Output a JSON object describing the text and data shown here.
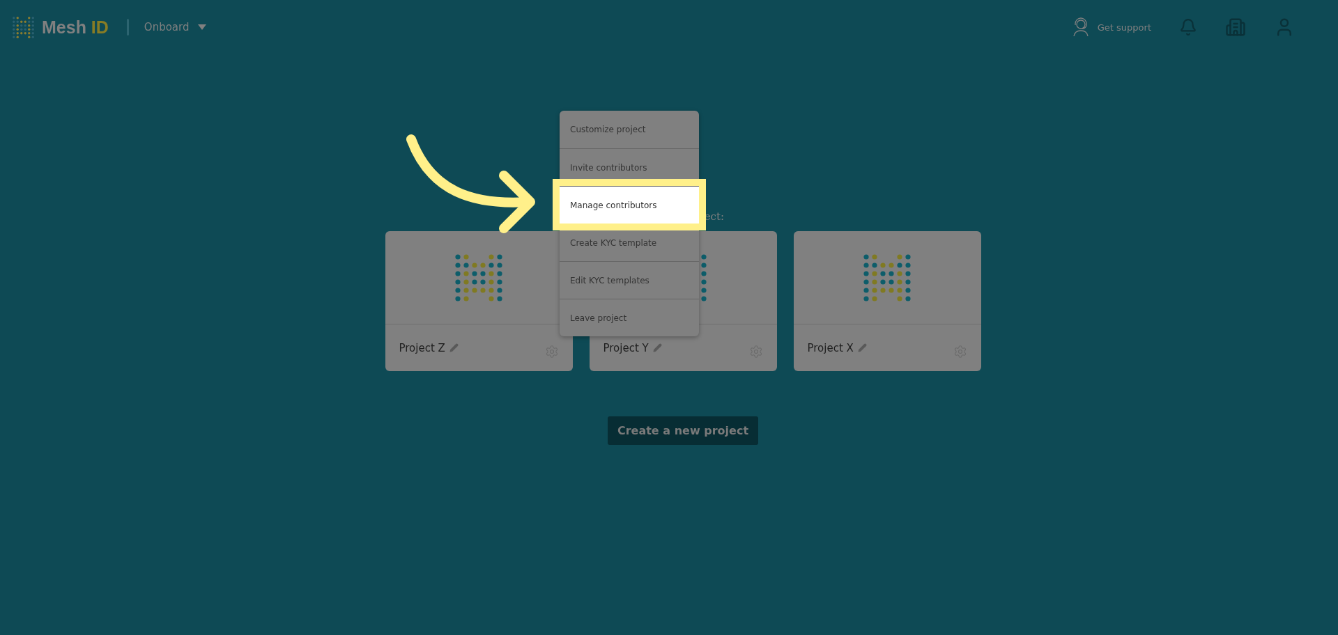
{
  "header": {
    "brand": {
      "first": "Mesh",
      "second": "ID"
    },
    "workspace": "Onboard",
    "support": "Get support"
  },
  "heading_fragment": "ect:",
  "projects": [
    {
      "name": "Project Z"
    },
    {
      "name": "Project Y"
    },
    {
      "name": "Project X"
    }
  ],
  "context_menu": [
    {
      "label": "Customize project",
      "selected": false
    },
    {
      "label": "Invite contributors",
      "selected": false
    },
    {
      "label": "Manage contributors",
      "selected": true
    },
    {
      "label": "Create KYC template",
      "selected": false
    },
    {
      "label": "Edit KYC templates",
      "selected": false
    },
    {
      "label": "Leave project",
      "selected": false
    }
  ],
  "create_button": "Create a new project"
}
